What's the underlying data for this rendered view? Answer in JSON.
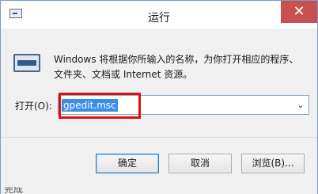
{
  "window": {
    "title": "运行",
    "close_glyph": "✕"
  },
  "dialog": {
    "description": "Windows 将根据你所输入的名称，为你打开相应的程序、文件夹、文档或 Internet 资源。",
    "open_label": "打开(O):",
    "command_value": "gpedit.msc",
    "dropdown_glyph": "⌄"
  },
  "buttons": {
    "ok_label": "确定",
    "cancel_label": "取消",
    "browse_label": "浏览(B)..."
  },
  "background": {
    "peek_text": "完成"
  },
  "icons": {
    "title": "run-app-icon",
    "main": "run-program-icon",
    "close": "close-icon",
    "dropdown": "chevron-down-icon"
  },
  "colors": {
    "highlight_box": "#e01010",
    "selection": "#3a8ee6",
    "close_button": "#c75050"
  }
}
